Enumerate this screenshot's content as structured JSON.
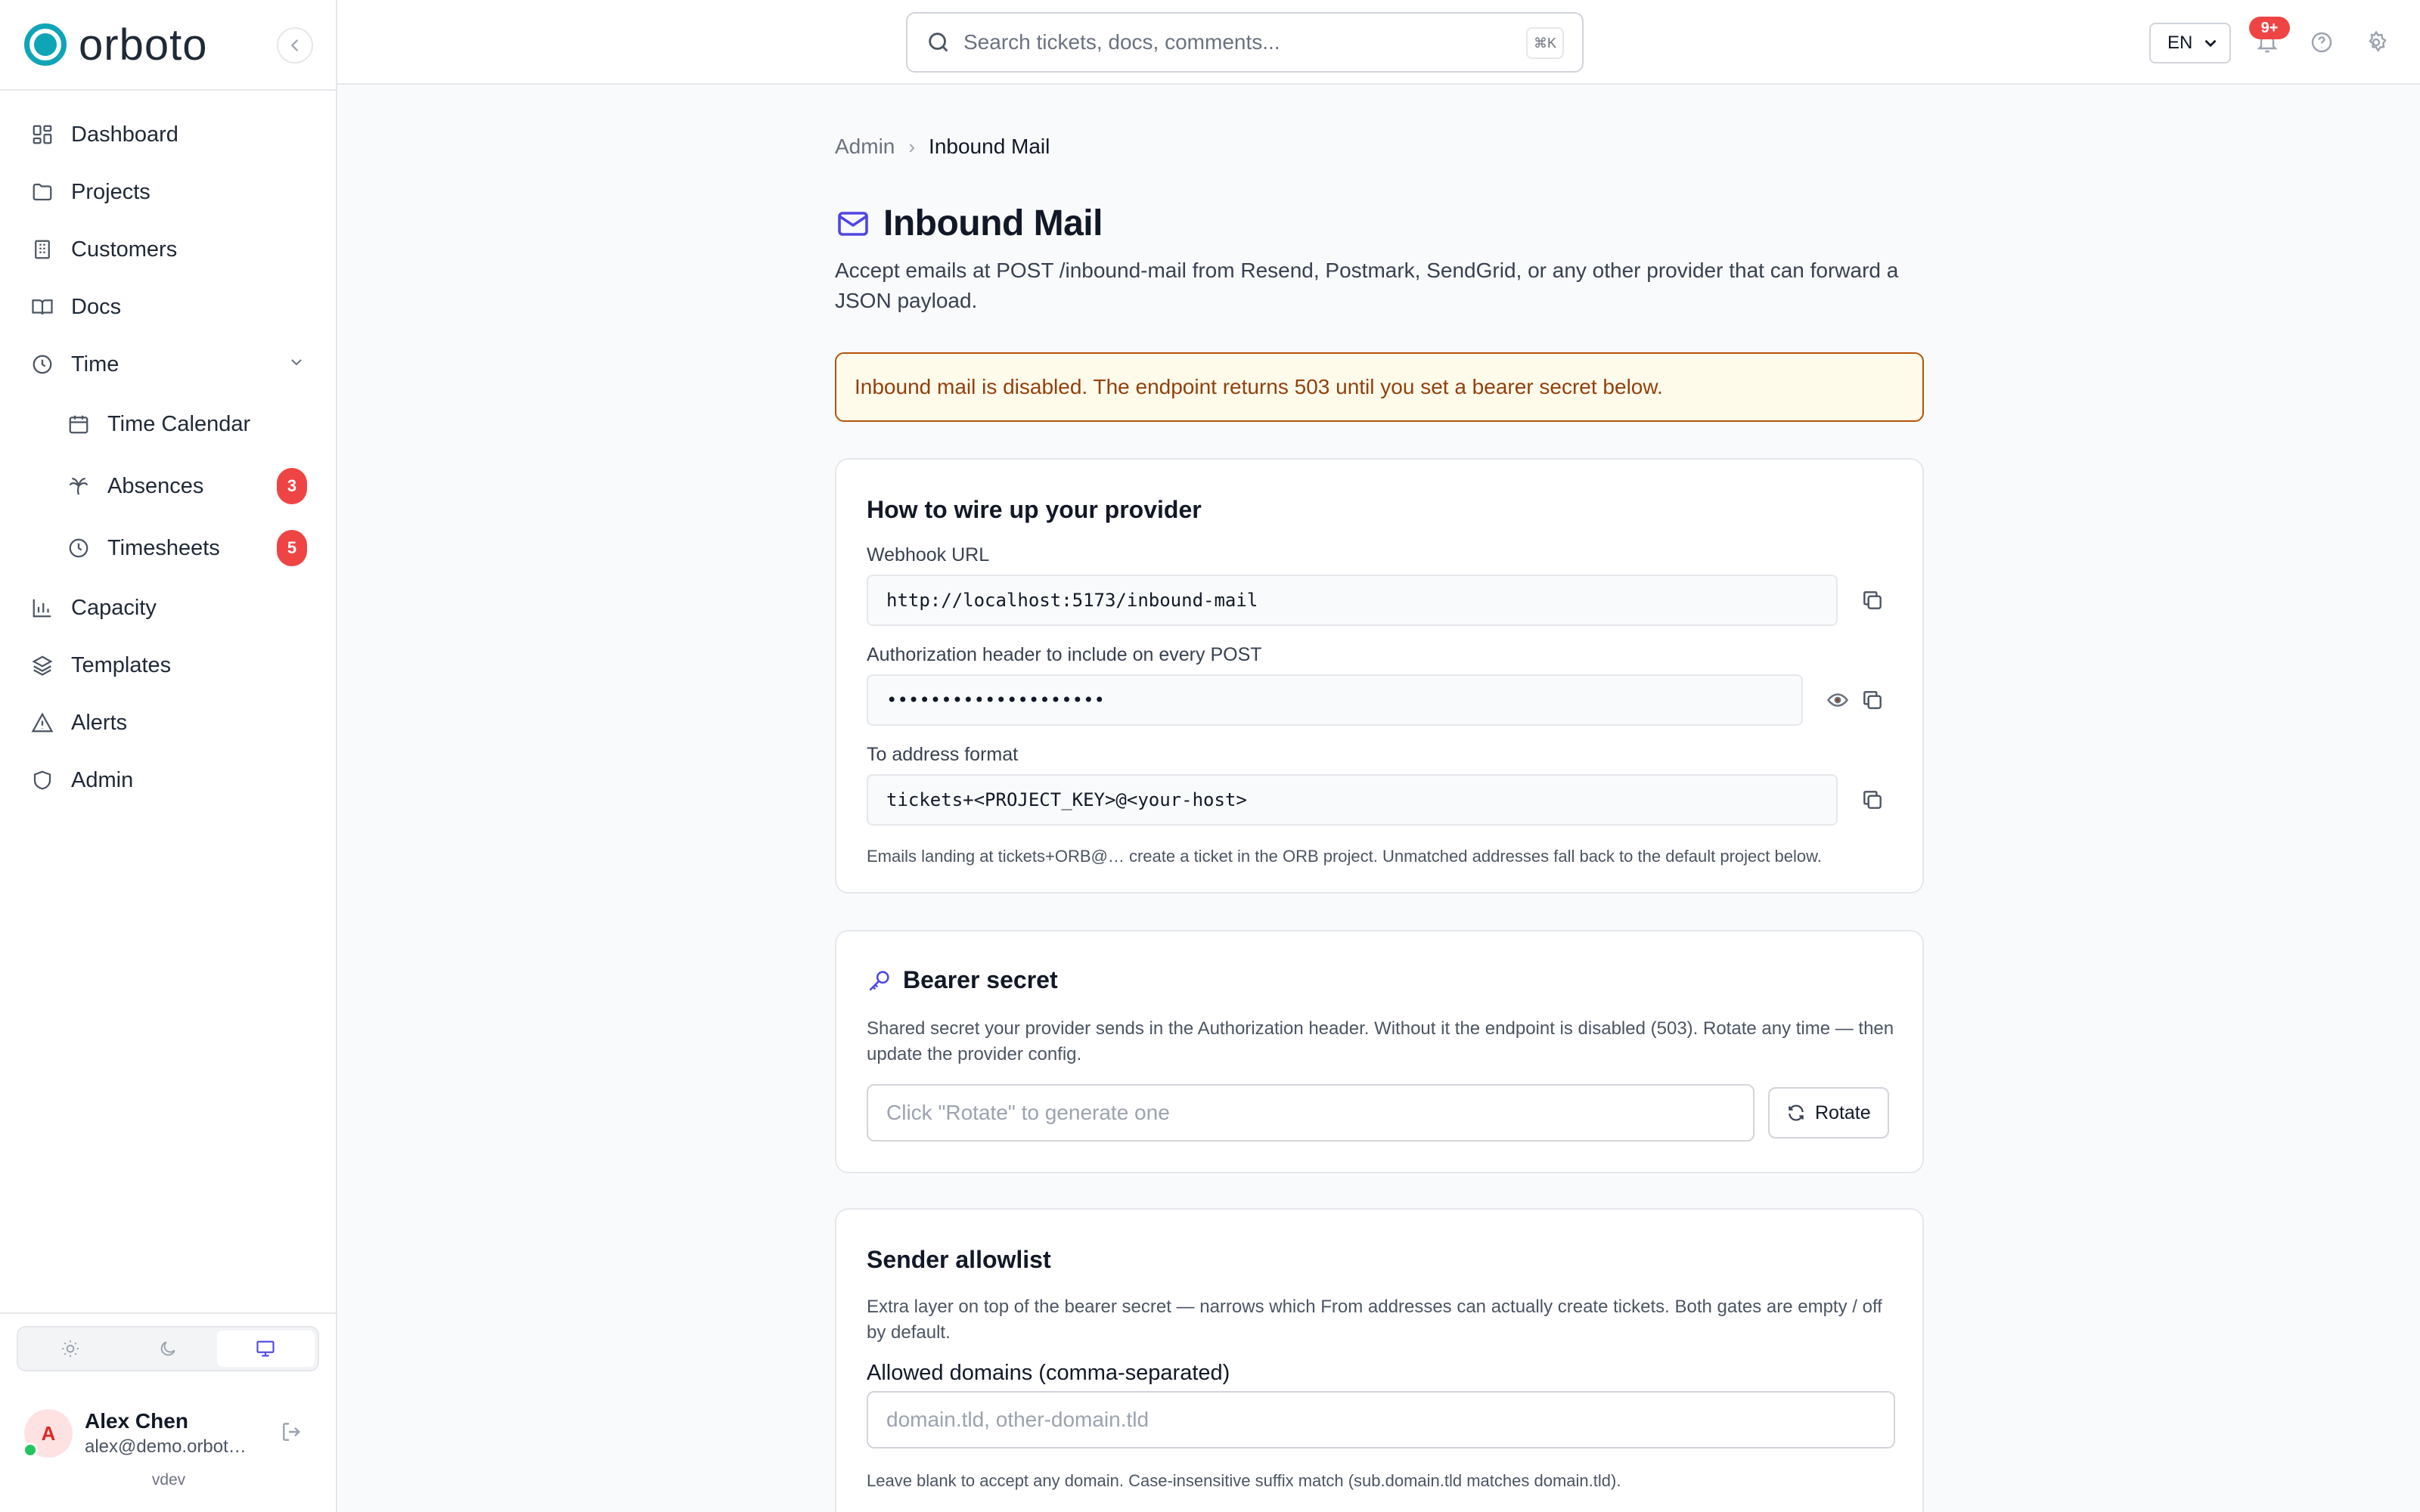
{
  "brand": {
    "name": "orboto"
  },
  "nav": {
    "items": [
      {
        "label": "Dashboard"
      },
      {
        "label": "Projects"
      },
      {
        "label": "Customers"
      },
      {
        "label": "Docs"
      },
      {
        "label": "Time"
      },
      {
        "label": "Time Calendar"
      },
      {
        "label": "Absences",
        "badge": "3"
      },
      {
        "label": "Timesheets",
        "badge": "5"
      },
      {
        "label": "Capacity"
      },
      {
        "label": "Templates"
      },
      {
        "label": "Alerts"
      },
      {
        "label": "Admin"
      }
    ]
  },
  "user": {
    "name": "Alex Chen",
    "email": "alex@demo.orbot…",
    "avatar_initial": "A",
    "version": "vdev"
  },
  "topbar": {
    "search_placeholder": "Search tickets, docs, comments...",
    "shortcut": "⌘K",
    "language": "EN",
    "notifications_badge": "9+"
  },
  "breadcrumb": {
    "parent": "Admin",
    "current": "Inbound Mail"
  },
  "page": {
    "title": "Inbound Mail",
    "description": "Accept emails at POST /inbound-mail from Resend, Postmark, SendGrid, or any other provider that can forward a JSON payload."
  },
  "alert": {
    "text": "Inbound mail is disabled. The endpoint returns 503 until you set a bearer secret below."
  },
  "wire_card": {
    "title": "How to wire up your provider",
    "webhook_label": "Webhook URL",
    "webhook_value": "http://localhost:5173/inbound-mail",
    "auth_label": "Authorization header to include on every POST",
    "auth_value": "••••••••••••••••••••",
    "to_label": "To address format",
    "to_value": "tickets+<PROJECT_KEY>@<your-host>",
    "to_hint": "Emails landing at tickets+ORB@… create a ticket in the ORB project. Unmatched addresses fall back to the default project below."
  },
  "bearer_card": {
    "title": "Bearer secret",
    "description": "Shared secret your provider sends in the Authorization header. Without it the endpoint is disabled (503). Rotate any time — then update the provider config.",
    "input_placeholder": "Click \"Rotate\" to generate one",
    "rotate_label": "Rotate"
  },
  "allowlist_card": {
    "title": "Sender allowlist",
    "description": "Extra layer on top of the bearer secret — narrows which From addresses can actually create tickets. Both gates are empty / off by default.",
    "domains_label": "Allowed domains (comma-separated)",
    "domains_placeholder": "domain.tld, other-domain.tld",
    "domains_hint": "Leave blank to accept any domain. Case-insensitive suffix match (sub.domain.tld matches domain.tld)."
  },
  "colors": {
    "accent": "#4f46e5",
    "brand": "#0ea5b7",
    "danger": "#ef4444",
    "warning_border": "#b45309",
    "warning_bg": "#fffbeb"
  }
}
